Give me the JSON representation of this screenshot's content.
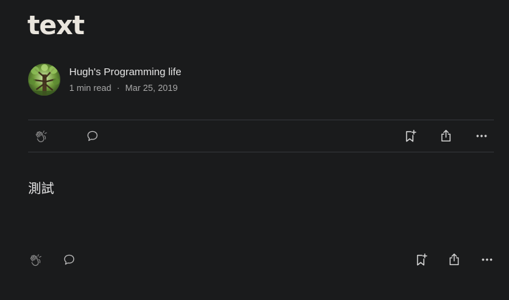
{
  "article": {
    "title": "text",
    "body": "測試"
  },
  "author": {
    "name": "Hugh's Programming life",
    "read_time": "1 min read",
    "separator": "·",
    "date": "Mar 25, 2019"
  },
  "actions": {
    "clap_icon": "clap-icon",
    "response_icon": "speech-bubble-icon",
    "save_icon": "bookmark-plus-icon",
    "share_icon": "share-icon",
    "more_icon": "ellipsis-icon"
  },
  "colors": {
    "background": "#1a1b1c",
    "text": "#e6e6e6",
    "muted": "#a8a8a8",
    "divider": "#34363a"
  }
}
